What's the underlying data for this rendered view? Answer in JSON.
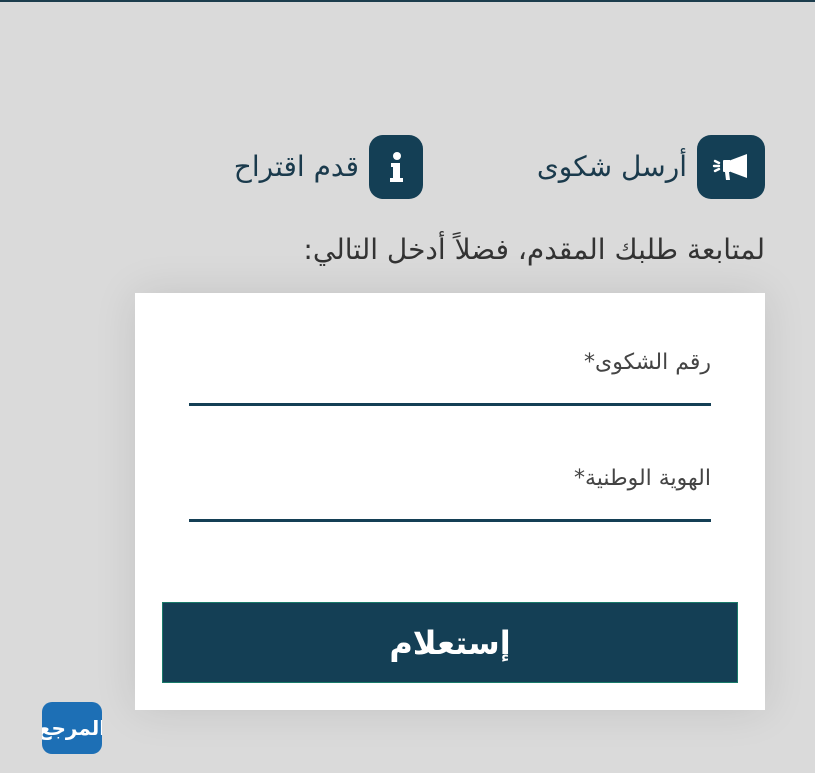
{
  "actions": {
    "complaint_label": "أرسل شكوى",
    "suggestion_label": "قدم اقتراح"
  },
  "instruction": "لمتابعة طلبك المقدم، فضلاً أدخل التالي:",
  "form": {
    "complaint_number_label": "رقم الشكوى*",
    "national_id_label": "الهوية الوطنية*",
    "submit_label": "إستعلام"
  },
  "logo": {
    "text": "المرجع"
  },
  "colors": {
    "primary": "#143f55",
    "background": "#dadada",
    "card": "#ffffff"
  }
}
